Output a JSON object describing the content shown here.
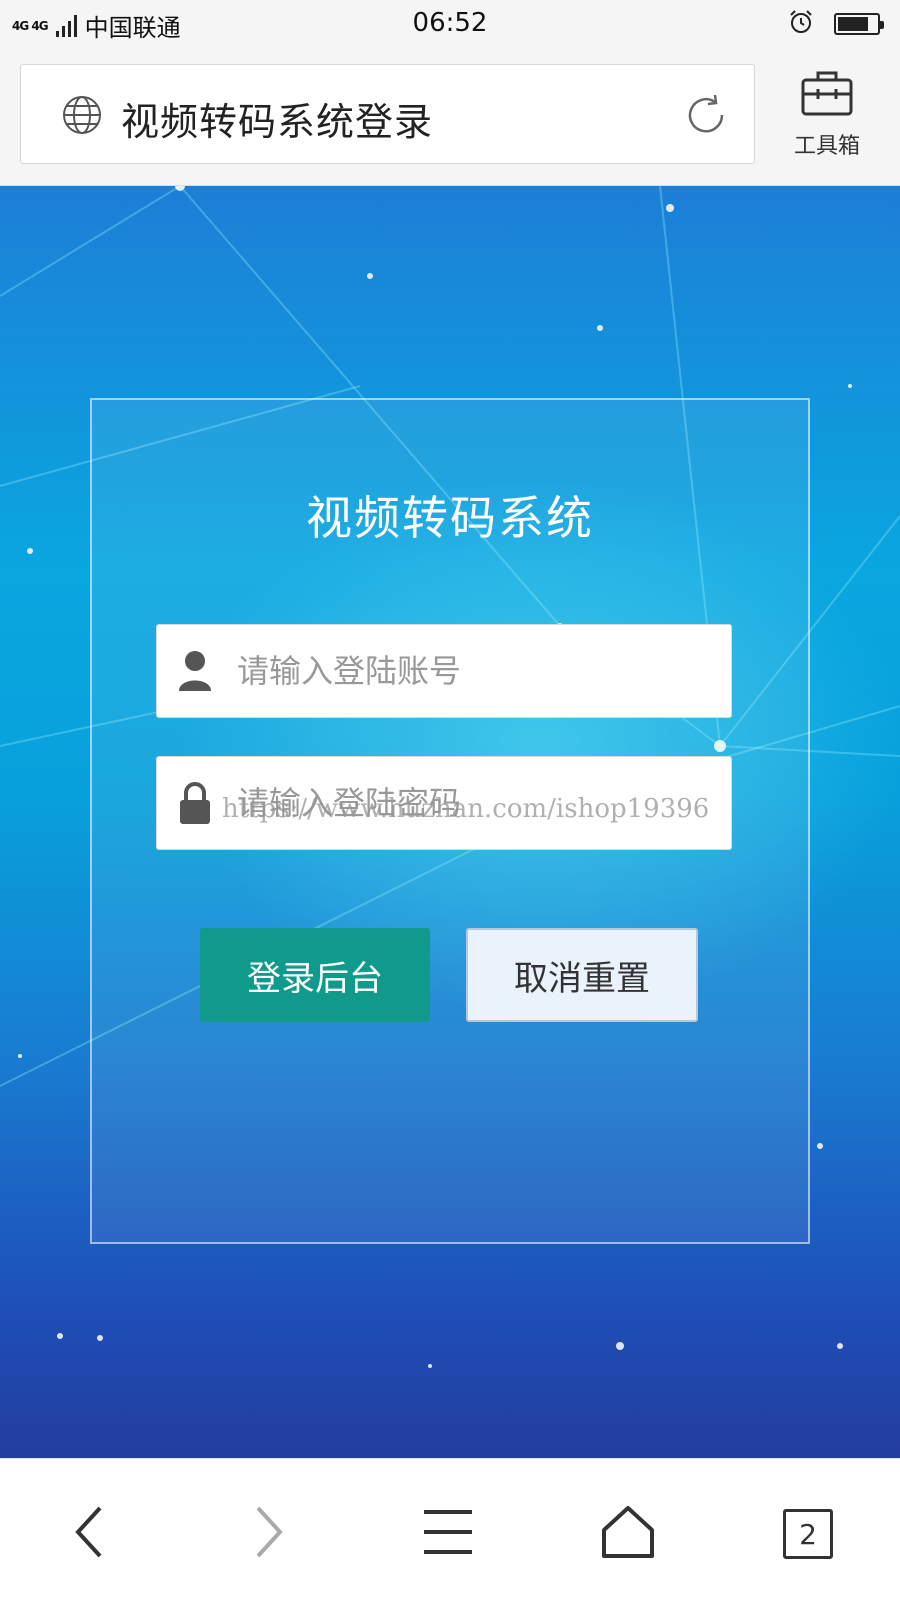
{
  "status_bar": {
    "network": "4G 4G",
    "carrier": "中国联通",
    "time": "06:52",
    "icons": [
      "signal-icon",
      "alarm-icon",
      "battery-icon"
    ],
    "battery_level": 0.8
  },
  "browser": {
    "page_title": "视频转码系统登录",
    "toolbox_label": "工具箱",
    "icons": [
      "globe-icon",
      "reload-icon",
      "toolbox-icon"
    ]
  },
  "login": {
    "title": "视频转码系统",
    "username_placeholder": "请输入登陆账号",
    "password_placeholder": "请输入登陆密码",
    "watermark": "https://www.huzhan.com/ishop19396",
    "login_button": "登录后台",
    "reset_button": "取消重置",
    "colors": {
      "login_button_bg": "#0f9a8b",
      "reset_button_bg": "#eaf2fb",
      "page_bg_top": "#1d7fd6",
      "page_bg_bottom": "#233d9f"
    }
  },
  "bottom_nav": {
    "items": [
      "back-icon",
      "forward-icon",
      "menu-icon",
      "home-icon",
      "tabs-icon"
    ],
    "tab_count": "2"
  }
}
